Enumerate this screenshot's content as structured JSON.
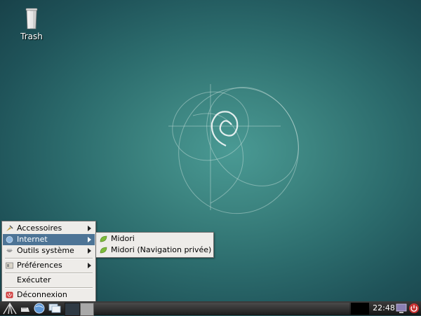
{
  "desktop": {
    "trash_label": "Trash"
  },
  "menu": {
    "items": [
      {
        "label": "Accessoires",
        "icon": "accessories-icon",
        "submenu": true
      },
      {
        "label": "Internet",
        "icon": "internet-icon",
        "submenu": true,
        "active": true
      },
      {
        "label": "Outils système",
        "icon": "system-tools-icon",
        "submenu": true
      },
      {
        "label": "Préférences",
        "icon": "preferences-icon",
        "submenu": true
      },
      {
        "label": "Exécuter",
        "icon": "",
        "submenu": false
      },
      {
        "label": "Déconnexion",
        "icon": "logout-icon",
        "submenu": false
      }
    ]
  },
  "submenu": {
    "items": [
      {
        "label": "Midori",
        "icon": "midori-icon"
      },
      {
        "label": "Midori (Navigation privée)",
        "icon": "midori-icon"
      }
    ]
  },
  "panel": {
    "clock": "22:48"
  },
  "colors": {
    "menu_highlight": "#4d7496",
    "menu_bg": "#eeece9",
    "panel_bg": "#1e1e1e"
  }
}
